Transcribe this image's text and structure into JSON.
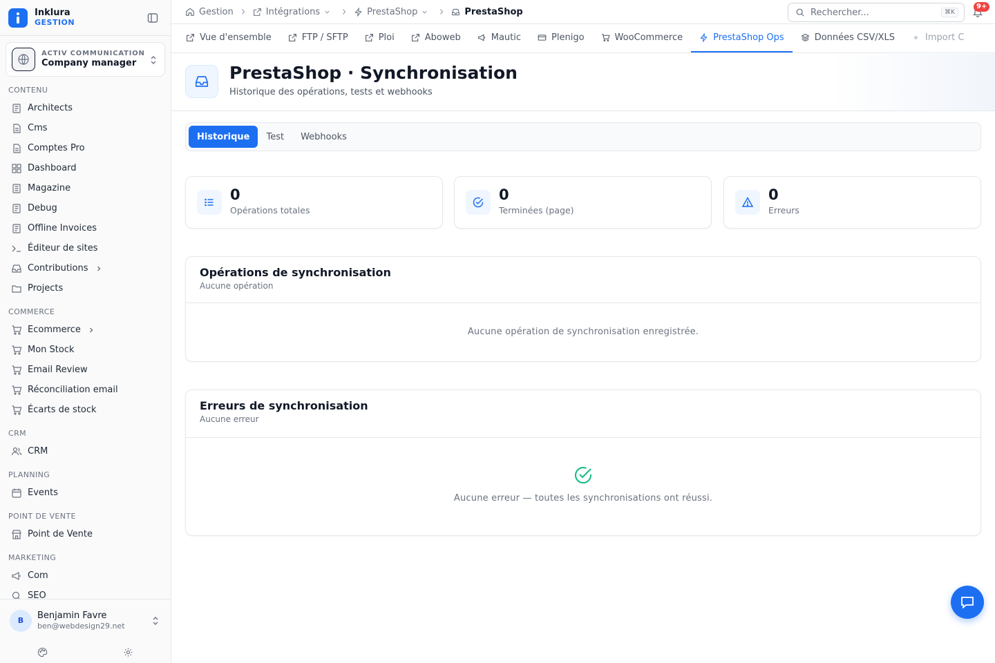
{
  "brand": {
    "name": "Inklura",
    "sub": "GESTION"
  },
  "company": {
    "label": "ACTIV COMMUNICATION",
    "role": "Company manager"
  },
  "sidebar": {
    "sections": [
      {
        "title": "CONTENU",
        "items": [
          "Architects",
          "Cms",
          "Comptes Pro",
          "Dashboard",
          "Magazine",
          "Debug",
          "Offline Invoices",
          "Éditeur de sites",
          "Contributions",
          "Projects"
        ]
      },
      {
        "title": "COMMERCE",
        "items": [
          "Ecommerce",
          "Mon Stock",
          "Email Review",
          "Réconciliation email",
          "Écarts de stock"
        ]
      },
      {
        "title": "CRM",
        "items": [
          "CRM"
        ]
      },
      {
        "title": "PLANNING",
        "items": [
          "Events"
        ]
      },
      {
        "title": "POINT DE VENTE",
        "items": [
          "Point de Vente"
        ]
      },
      {
        "title": "MARKETING",
        "items": [
          "Com",
          "SEO"
        ]
      }
    ]
  },
  "user": {
    "initial": "B",
    "name": "Benjamin Favre",
    "email": "ben@webdesign29.net"
  },
  "breadcrumb": [
    "Gestion",
    "Intégrations",
    "PrestaShop",
    "PrestaShop"
  ],
  "search": {
    "placeholder": "Rechercher...",
    "shortcut": "⌘K"
  },
  "notifications": {
    "badge": "9+"
  },
  "tabs": [
    "Vue d'ensemble",
    "FTP / SFTP",
    "Ploi",
    "Aboweb",
    "Mautic",
    "Plenigo",
    "WooCommerce",
    "PrestaShop Ops",
    "Données CSV/XLS",
    "Import C"
  ],
  "header": {
    "title": "PrestaShop · Synchronisation",
    "subtitle": "Historique des opérations, tests et webhooks"
  },
  "subtabs": [
    "Historique",
    "Test",
    "Webhooks"
  ],
  "stats": [
    {
      "value": "0",
      "label": "Opérations totales"
    },
    {
      "value": "0",
      "label": "Terminées (page)"
    },
    {
      "value": "0",
      "label": "Erreurs"
    }
  ],
  "operations": {
    "title": "Opérations de synchronisation",
    "subtitle": "Aucune opération",
    "empty": "Aucune opération de synchronisation enregistrée."
  },
  "errors": {
    "title": "Erreurs de synchronisation",
    "subtitle": "Aucune erreur",
    "empty": "Aucune erreur — toutes les synchronisations ont réussi."
  },
  "colors": {
    "accent": "#1d6ff2",
    "success": "#10b981",
    "badge": "#ef4444"
  }
}
